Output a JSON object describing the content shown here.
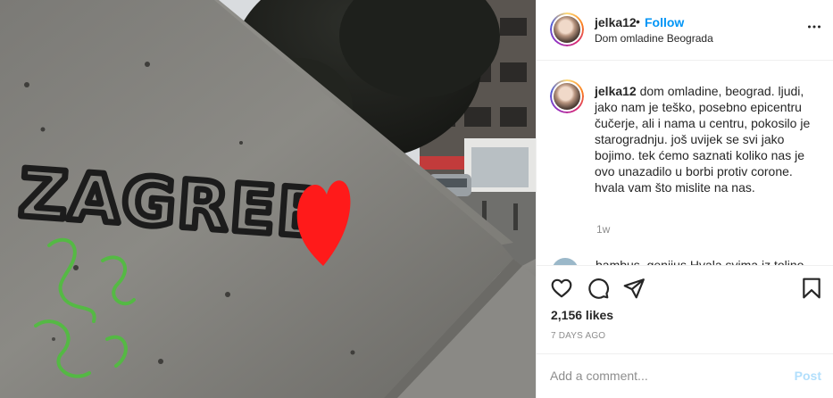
{
  "photo": {
    "alt": "Concrete wall with graffiti",
    "graffiti_text": "ZAGREB",
    "heart_color": "#ff1a1a",
    "paint_color": "#1c1c1c",
    "green_color": "#4cc23a"
  },
  "post": {
    "username": "jelka12",
    "separator": "•",
    "follow_label": "Follow",
    "location": "Dom omladine Beograda",
    "more_icon": "more-horizontal-icon"
  },
  "caption": {
    "username": "jelka12",
    "text": "dom omladine, beograd. ljudi, jako nam je teško, posebno epicentru čučerje, ali i nama u centru, pokosilo je starogradnju. još uvijek se svi jako bojimo. tek ćemo saznati koliko nas je ovo unazadilo u borbi protiv corone. hvala vam što mislite na nas.",
    "age": "1w"
  },
  "next_comment": {
    "text": "bambus_geniius Hvala svima iz tolino..."
  },
  "actions": {
    "like_icon": "heart-icon",
    "comment_icon": "comment-icon",
    "share_icon": "paper-plane-icon",
    "save_icon": "bookmark-icon"
  },
  "stats": {
    "likes": "2,156 likes",
    "posted": "7 DAYS AGO"
  },
  "composer": {
    "placeholder": "Add a comment...",
    "post_label": "Post"
  }
}
